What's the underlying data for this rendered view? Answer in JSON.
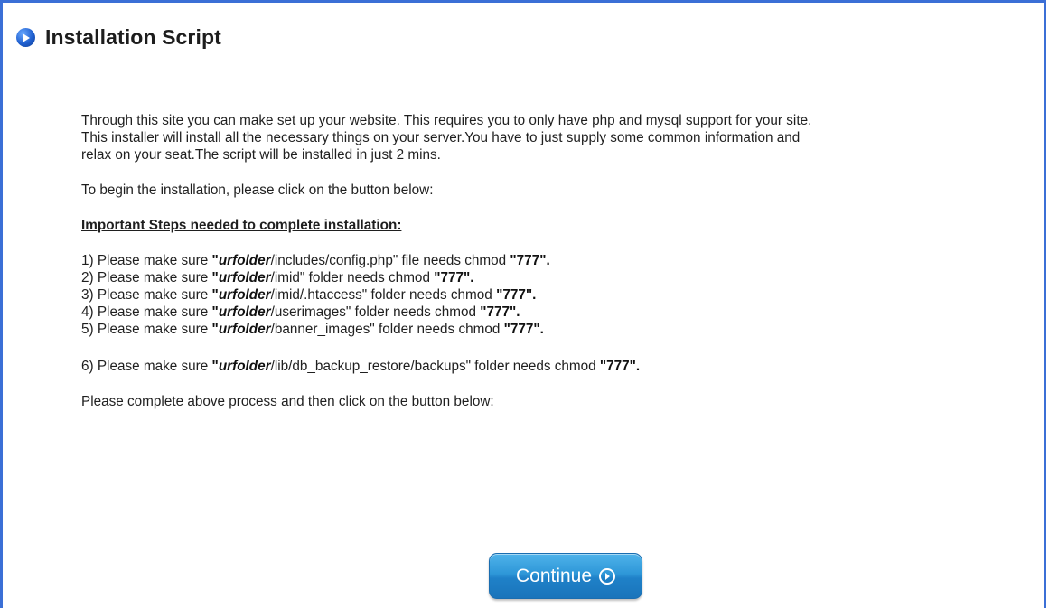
{
  "header": {
    "title": "Installation Script",
    "icon": "play-circle-icon"
  },
  "intro": {
    "line1": "Through this site you can make set up your website. This requires you to only have php and mysql support for your site.",
    "line2": "This installer will install all the necessary things on your server.You have to just supply some common information and",
    "line3": "relax on your seat.The script will be installed in just 2 mins."
  },
  "begin_text": "To begin the installation, please click on the button below:",
  "steps_heading": "Important Steps needed to complete installation:",
  "steps": [
    {
      "prefix": "1) Please make sure ",
      "folder": "urfolder",
      "path": "/includes/config.php\"",
      "suffix_plain": " file needs chmod ",
      "chmod": "\"777\"."
    },
    {
      "prefix": "2) Please make sure ",
      "folder": "urfolder",
      "path": "/imid\"",
      "suffix_plain": " folder needs chmod ",
      "chmod": "\"777\"."
    },
    {
      "prefix": "3) Please make sure ",
      "folder": "urfolder",
      "path": "/imid/.htaccess\"",
      "suffix_plain": " folder needs chmod ",
      "chmod": "\"777\"."
    },
    {
      "prefix": "4) Please make sure ",
      "folder": "urfolder",
      "path": "/userimages\"",
      "suffix_plain": " folder needs chmod ",
      "chmod": "\"777\"."
    },
    {
      "prefix": "5) Please make sure ",
      "folder": "urfolder",
      "path": "/banner_images\"",
      "suffix_plain": " folder needs chmod ",
      "chmod": "\"777\"."
    },
    {
      "prefix": "6) Please make sure ",
      "folder": "urfolder",
      "path": "/lib/db_backup_restore/backups\"",
      "suffix_plain": " folder needs chmod ",
      "chmod": "\"777\"."
    }
  ],
  "quote_open": "\"",
  "complete_text": "Please complete above process and then click on the button below:",
  "continue_button": {
    "label": "Continue",
    "icon": "arrow-right-circle-icon"
  },
  "colors": {
    "frame_border": "#3b6fd6",
    "button": "#2e97d8"
  }
}
